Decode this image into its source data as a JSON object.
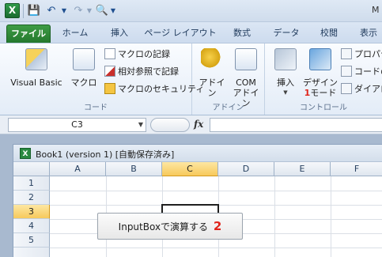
{
  "qat": {
    "title_fragment": "M"
  },
  "tabs": [
    "ファイル",
    "ホーム",
    "挿入",
    "ページ レイアウト",
    "数式",
    "データ",
    "校閲",
    "表示"
  ],
  "ribbon": {
    "code": {
      "visual_basic": "Visual Basic",
      "macro": "マクロ",
      "record_macro": "マクロの記録",
      "relative_ref": "相対参照で記録",
      "macro_security": "マクロのセキュリティ",
      "label": "コード"
    },
    "addins": {
      "addin": "アドイン",
      "com_addin_1": "COM",
      "com_addin_2": "アドイン",
      "label": "アドイン"
    },
    "controls": {
      "insert": "挿入",
      "design_mode_1": "デザイン",
      "design_mode_2": "モード",
      "annotation_1": "1",
      "properties": "プロパテ",
      "view_code": "コードの",
      "dialog": "ダイアロ",
      "label": "コントロール"
    }
  },
  "formula_bar": {
    "name_box": "C3",
    "fx": "fx",
    "value": ""
  },
  "workbook": {
    "title": "Book1 (version 1) [自動保存済み]",
    "columns": [
      "A",
      "B",
      "C",
      "D",
      "E",
      "F"
    ],
    "rows": [
      "1",
      "2",
      "3",
      "4",
      "5"
    ],
    "selected_column": "C",
    "selected_row": "3"
  },
  "macro_button": {
    "label": "InputBoxで演算する",
    "annotation": "2"
  }
}
